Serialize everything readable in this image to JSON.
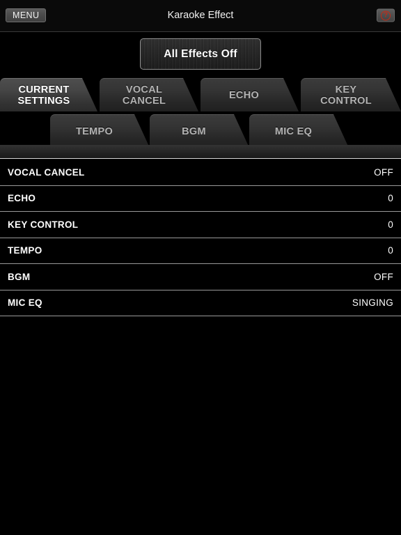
{
  "topbar": {
    "menu_label": "MENU",
    "title": "Karaoke Effect",
    "help_icon": "help-question-icon",
    "help_glyph": "?",
    "help_color": "#c02b16"
  },
  "actions": {
    "all_effects_off_label": "All Effects Off"
  },
  "tabs": {
    "row1": [
      {
        "label": "CURRENT\nSETTINGS",
        "active": true
      },
      {
        "label": "VOCAL\nCANCEL",
        "active": false
      },
      {
        "label": "ECHO",
        "active": false
      },
      {
        "label": "KEY\nCONTROL",
        "active": false
      }
    ],
    "row2": [
      {
        "label": "TEMPO",
        "active": false
      },
      {
        "label": "BGM",
        "active": false
      },
      {
        "label": "MIC EQ",
        "active": false
      }
    ]
  },
  "settings_list": {
    "rows": [
      {
        "label": "VOCAL CANCEL",
        "value": "OFF"
      },
      {
        "label": "ECHO",
        "value": "0"
      },
      {
        "label": "KEY CONTROL",
        "value": "0"
      },
      {
        "label": "TEMPO",
        "value": "0"
      },
      {
        "label": "BGM",
        "value": "OFF"
      },
      {
        "label": "MIC EQ",
        "value": "SINGING"
      }
    ]
  },
  "colors": {
    "background": "#000000",
    "tab_active_text": "#ffffff",
    "tab_inactive_text": "#b3b3b3",
    "separator": "#9a9a9a",
    "accent_red": "#c02b16"
  }
}
